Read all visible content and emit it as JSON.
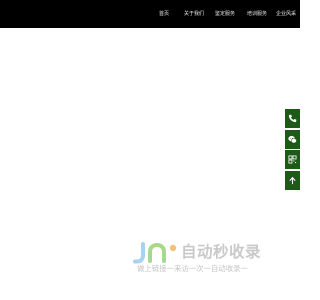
{
  "nav": {
    "items": [
      {
        "label": "首页"
      },
      {
        "label": "关于我们"
      },
      {
        "label": "鉴定服务"
      },
      {
        "label": "培训服务"
      },
      {
        "label": "企业风采"
      }
    ]
  },
  "sidebar": {
    "buttons": [
      {
        "icon": "phone-icon"
      },
      {
        "icon": "wechat-icon"
      },
      {
        "icon": "qrcode-icon"
      },
      {
        "icon": "arrow-up-icon"
      }
    ],
    "color": "#1e5a17"
  },
  "watermark": {
    "title": "自动秒收录",
    "subtitle": "做上链接一来访一次一自动收录一"
  }
}
